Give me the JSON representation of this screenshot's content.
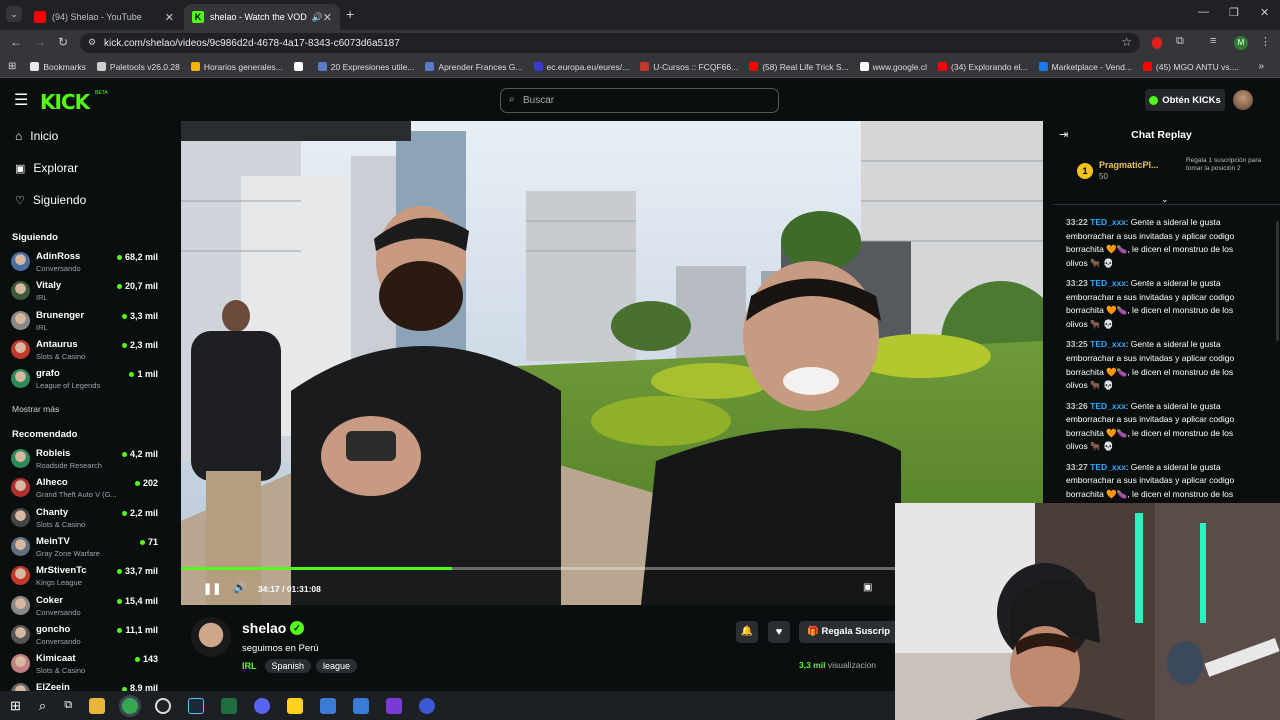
{
  "browser": {
    "tabs": [
      {
        "title": "(94) Shelao - YouTube",
        "color": "#ff0000"
      },
      {
        "title": "shelao - Watch the VOD on",
        "color": "#53fc18"
      }
    ],
    "url": "kick.com/shelao/videos/9c986d2d-4678-4a17-8343-c6073d6a5187",
    "bookmarks": [
      {
        "label": "Bookmarks",
        "color": "#e8eaed"
      },
      {
        "label": "Paletools v26.0.28",
        "color": "#cfcfcf"
      },
      {
        "label": "Horarios generales...",
        "color": "#f4b400"
      },
      {
        "label": "",
        "color": "#ffffff"
      },
      {
        "label": "20 Expresiones utile...",
        "color": "#5a7ac8"
      },
      {
        "label": "Aprender Frances G...",
        "color": "#5a7ac8"
      },
      {
        "label": "ec.europa.eu/eures/...",
        "color": "#3a3ad0"
      },
      {
        "label": "U-Cursos :: FCQF66...",
        "color": "#c0392b"
      },
      {
        "label": "(58) Real Life Trick S...",
        "color": "#ff0000"
      },
      {
        "label": "www.google.cl",
        "color": "#ffffff"
      },
      {
        "label": "(34) Explorando el...",
        "color": "#ff0000"
      },
      {
        "label": "Marketplace - Vend...",
        "color": "#1877f2"
      },
      {
        "label": "(45) MGO ANTU vs....",
        "color": "#ff0000"
      }
    ]
  },
  "header": {
    "logo": "KICK",
    "search_placeholder": "Buscar",
    "kicks_button": "Obtén KICKs"
  },
  "nav": [
    {
      "label": "Inicio",
      "icon": "home-icon"
    },
    {
      "label": "Explorar",
      "icon": "compass-icon"
    },
    {
      "label": "Siguiendo",
      "icon": "heart-icon"
    }
  ],
  "following": {
    "heading": "Siguiendo",
    "channels": [
      {
        "name": "AdinRoss",
        "category": "Conversando",
        "viewers": "68,2 mil",
        "color": "#4a6fa5"
      },
      {
        "name": "Vitaly",
        "category": "IRL",
        "viewers": "20,7 mil",
        "color": "#3a5a3a"
      },
      {
        "name": "Brunenger",
        "category": "IRL",
        "viewers": "3,3 mil",
        "color": "#888888"
      },
      {
        "name": "Antaurus",
        "category": "Slots & Casino",
        "viewers": "2,3 mil",
        "color": "#c0392b"
      },
      {
        "name": "grafo",
        "category": "League of Legends",
        "viewers": "1 mil",
        "color": "#2e8b57"
      }
    ],
    "show_more": "Mostrar más"
  },
  "recommended": {
    "heading": "Recomendado",
    "channels": [
      {
        "name": "Robleis",
        "category": "Roadside Research",
        "viewers": "4,2 mil",
        "color": "#2e8b57"
      },
      {
        "name": "Alheco",
        "category": "Grand Theft Auto V (G...",
        "viewers": "202",
        "color": "#b03030"
      },
      {
        "name": "Chanty",
        "category": "Slots & Casino",
        "viewers": "2,2 mil",
        "color": "#444444"
      },
      {
        "name": "MeinTV",
        "category": "Gray Zone Warfare",
        "viewers": "71",
        "color": "#607080"
      },
      {
        "name": "MrStivenTc",
        "category": "Kings League",
        "viewers": "33,7 mil",
        "color": "#c0392b"
      },
      {
        "name": "Coker",
        "category": "Conversando",
        "viewers": "15,4 mil",
        "color": "#888888"
      },
      {
        "name": "goncho",
        "category": "Conversando",
        "viewers": "11,1 mil",
        "color": "#555555"
      },
      {
        "name": "Kimicaat",
        "category": "Slots & Casino",
        "viewers": "143",
        "color": "#c08080"
      },
      {
        "name": "ElZeein",
        "category": "",
        "viewers": "8,9 mil",
        "color": "#666666"
      }
    ]
  },
  "player": {
    "time": "34:17 / 01:31:08",
    "progress": 0.376
  },
  "channel": {
    "name": "shelao",
    "title": "seguimos en Perú",
    "category": "IRL",
    "tags": [
      "Spanish",
      "league"
    ],
    "subscribe_label": "Regala Suscrip",
    "views_count": "3,3 mil",
    "views_label": "visualizacion"
  },
  "chat": {
    "title": "Chat Replay",
    "pinned": {
      "rank": "1",
      "user": "PragmaticPl...",
      "amount": "50",
      "note": "Regala 1 suscripción para tomar la posición 2"
    },
    "messages": [
      {
        "time": "33:22",
        "user": "TED_xxx",
        "text": "Gente a sideral le gusta emborrachar a sus invitadas y aplicar codigo borrachita 🧡🍆, le dicen el monstruo de los olivos 🐂 💀"
      },
      {
        "time": "33:23",
        "user": "TED_xxx",
        "text": "Gente a sideral le gusta emborrachar a sus invitadas y aplicar codigo borrachita 🧡🍆, le dicen el monstruo de los olivos 🐂 💀"
      },
      {
        "time": "33:25",
        "user": "TED_xxx",
        "text": "Gente a sideral le gusta emborrachar a sus invitadas y aplicar codigo borrachita 🧡🍆, le dicen el monstruo de los olivos 🐂 💀"
      },
      {
        "time": "33:26",
        "user": "TED_xxx",
        "text": "Gente a sideral le gusta emborrachar a sus invitadas y aplicar codigo borrachita 🧡🍆, le dicen el monstruo de los olivos 🐂 💀"
      },
      {
        "time": "33:27",
        "user": "TED_xxx",
        "text": "Gente a sideral le gusta emborrachar a sus invitadas y aplicar codigo borrachita 🧡🍆, le dicen el monstruo de los"
      }
    ]
  },
  "colors": {
    "accent": "#53fc18",
    "bg": "#0b0e0f",
    "username": "#2ea8ff"
  }
}
